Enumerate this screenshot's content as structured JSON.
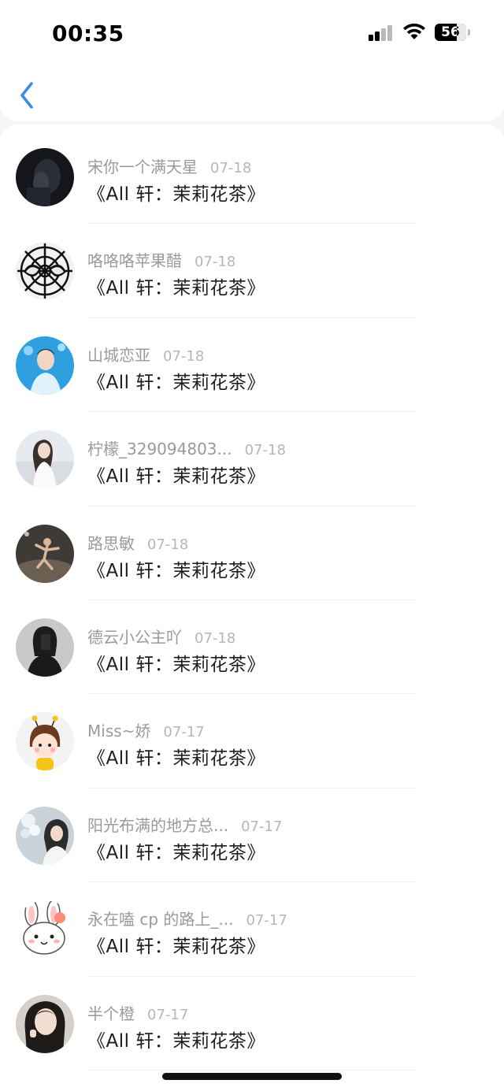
{
  "status_bar": {
    "time": "00:35",
    "battery": "56"
  },
  "nav": {
    "back_icon": "chevron-left-icon"
  },
  "comments": [
    {
      "user": "宋你一个满天星",
      "date": "07-18",
      "title": "《All 轩：茉莉花茶》",
      "avatar": "dark-portrait"
    },
    {
      "user": "咯咯咯苹果醋",
      "date": "07-18",
      "title": "《All 轩：茉莉花茶》",
      "avatar": "spider-mask"
    },
    {
      "user": "山城恋亚",
      "date": "07-18",
      "title": "《All 轩：茉莉花茶》",
      "avatar": "blue-stage-boy"
    },
    {
      "user": "柠檬_329094803...",
      "date": "07-18",
      "title": "《All 轩：茉莉花茶》",
      "avatar": "girl-white-dress"
    },
    {
      "user": "路思敏",
      "date": "07-18",
      "title": "《All 轩：茉莉花茶》",
      "avatar": "stage-dancer"
    },
    {
      "user": "德云小公主吖",
      "date": "07-18",
      "title": "《All 轩：茉莉花茶》",
      "avatar": "mirror-selfie"
    },
    {
      "user": "Miss~娇",
      "date": "07-17",
      "title": "《All 轩：茉莉花茶》",
      "avatar": "bee-girl-cartoon"
    },
    {
      "user": "阳光布满的地方总...",
      "date": "07-17",
      "title": "《All 轩：茉莉花茶》",
      "avatar": "flowers-girl"
    },
    {
      "user": "永在嗑 cp 的路上_...",
      "date": "07-17",
      "title": "《All 轩：茉莉花茶》",
      "avatar": "bunny-cartoon"
    },
    {
      "user": "半个橙",
      "date": "07-17",
      "title": "《All 轩：茉莉花茶》",
      "avatar": "girl-portrait"
    }
  ],
  "colors": {
    "accent": "#3a8de6",
    "username": "#9a9a9a",
    "date": "#b6b6b6",
    "title": "#1d1d1d",
    "background": "#f4f5f7"
  }
}
